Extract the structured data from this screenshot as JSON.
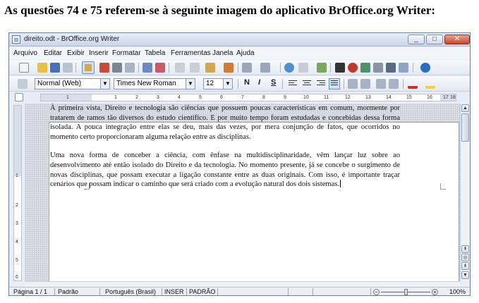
{
  "question": {
    "heading": "As questões 74 e 75 referem-se à seguinte imagem do aplicativo BrOffice.org Writer:"
  },
  "window": {
    "title": "direito.odt - BrOffice.org Writer",
    "minimize": "_",
    "maximize": "□",
    "close": "✕"
  },
  "menu": {
    "items": [
      "Arquivo",
      "Editar",
      "Exibir",
      "Inserir",
      "Formatar",
      "Tabela",
      "Ferramentas",
      "Janela",
      "Ajuda"
    ]
  },
  "format_toolbar": {
    "style": "Normal (Web)",
    "font": "Times New Roman",
    "size": "12",
    "bold": "N",
    "italic": "I",
    "underline": "S",
    "dropdown_arrow": "▼"
  },
  "ruler": {
    "h_marks": [
      "1",
      "1",
      "2",
      "3",
      "4",
      "5",
      "6",
      "7",
      "8",
      "9",
      "10",
      "11",
      "12",
      "13",
      "14",
      "15",
      "16",
      "17",
      "18"
    ],
    "v_marks": [
      "1",
      "2",
      "3",
      "4",
      "5",
      "6"
    ]
  },
  "document": {
    "paragraphs": [
      "À primeira vista, Direito e tecnologia são ciências que possuem poucas características em comum, mormente por tratarem de ramos tão diversos do estudo científico. E por muito tempo foram estudadas e concebidas dessa forma isolada. A pouca integração entre elas se deu, mais das vezes, por mera conjunção de fatos, que ocorridos no momento certo proporcionaram alguma relação entre as disciplinas.",
      "Uma nova forma de conceber a ciência, com ênfase na multidisciplinaridade, vêm lançar luz sobre ao desenvolvimento até então isolado do Direito e da tecnologia. No momento presente, já se concebe o surgimento de novas disciplinas, que possam executar a ligação constante entre as duas originais. Com isso, é importante traçar cenários que possam indicar o caminho que será criado com a evolução natural dos dois sistemas."
    ]
  },
  "scrollbar": {
    "up": "▲",
    "down": "▼",
    "prev_page": "⇞",
    "nav": "◎",
    "next_page": "⇟"
  },
  "status": {
    "page": "Página 1 / 1",
    "page_style": "Padrão",
    "language": "Português (Brasil)",
    "insert_mode": "INSER",
    "selection_mode": "PADRÃO",
    "zoom": "100%",
    "zoom_out": "−",
    "zoom_in": "+"
  },
  "colors": {
    "accent": "#cfe0f7",
    "chrome": "#e7ecf5",
    "doc_background": "#dcdfe5"
  },
  "icons": [
    "new-document-icon",
    "open-icon",
    "save-icon",
    "email-icon",
    "edit-mode-icon",
    "export-pdf-icon",
    "print-icon",
    "print-preview-icon",
    "spellcheck-icon",
    "autospellcheck-icon",
    "cut-icon",
    "copy-icon",
    "paste-icon",
    "clone-format-icon",
    "undo-icon",
    "redo-icon",
    "hyperlink-icon",
    "table-icon",
    "draw-functions-icon",
    "find-replace-icon",
    "navigator-icon",
    "gallery-icon",
    "data-sources-icon",
    "nonprinting-chars-icon",
    "zoom-icon",
    "help-icon"
  ]
}
